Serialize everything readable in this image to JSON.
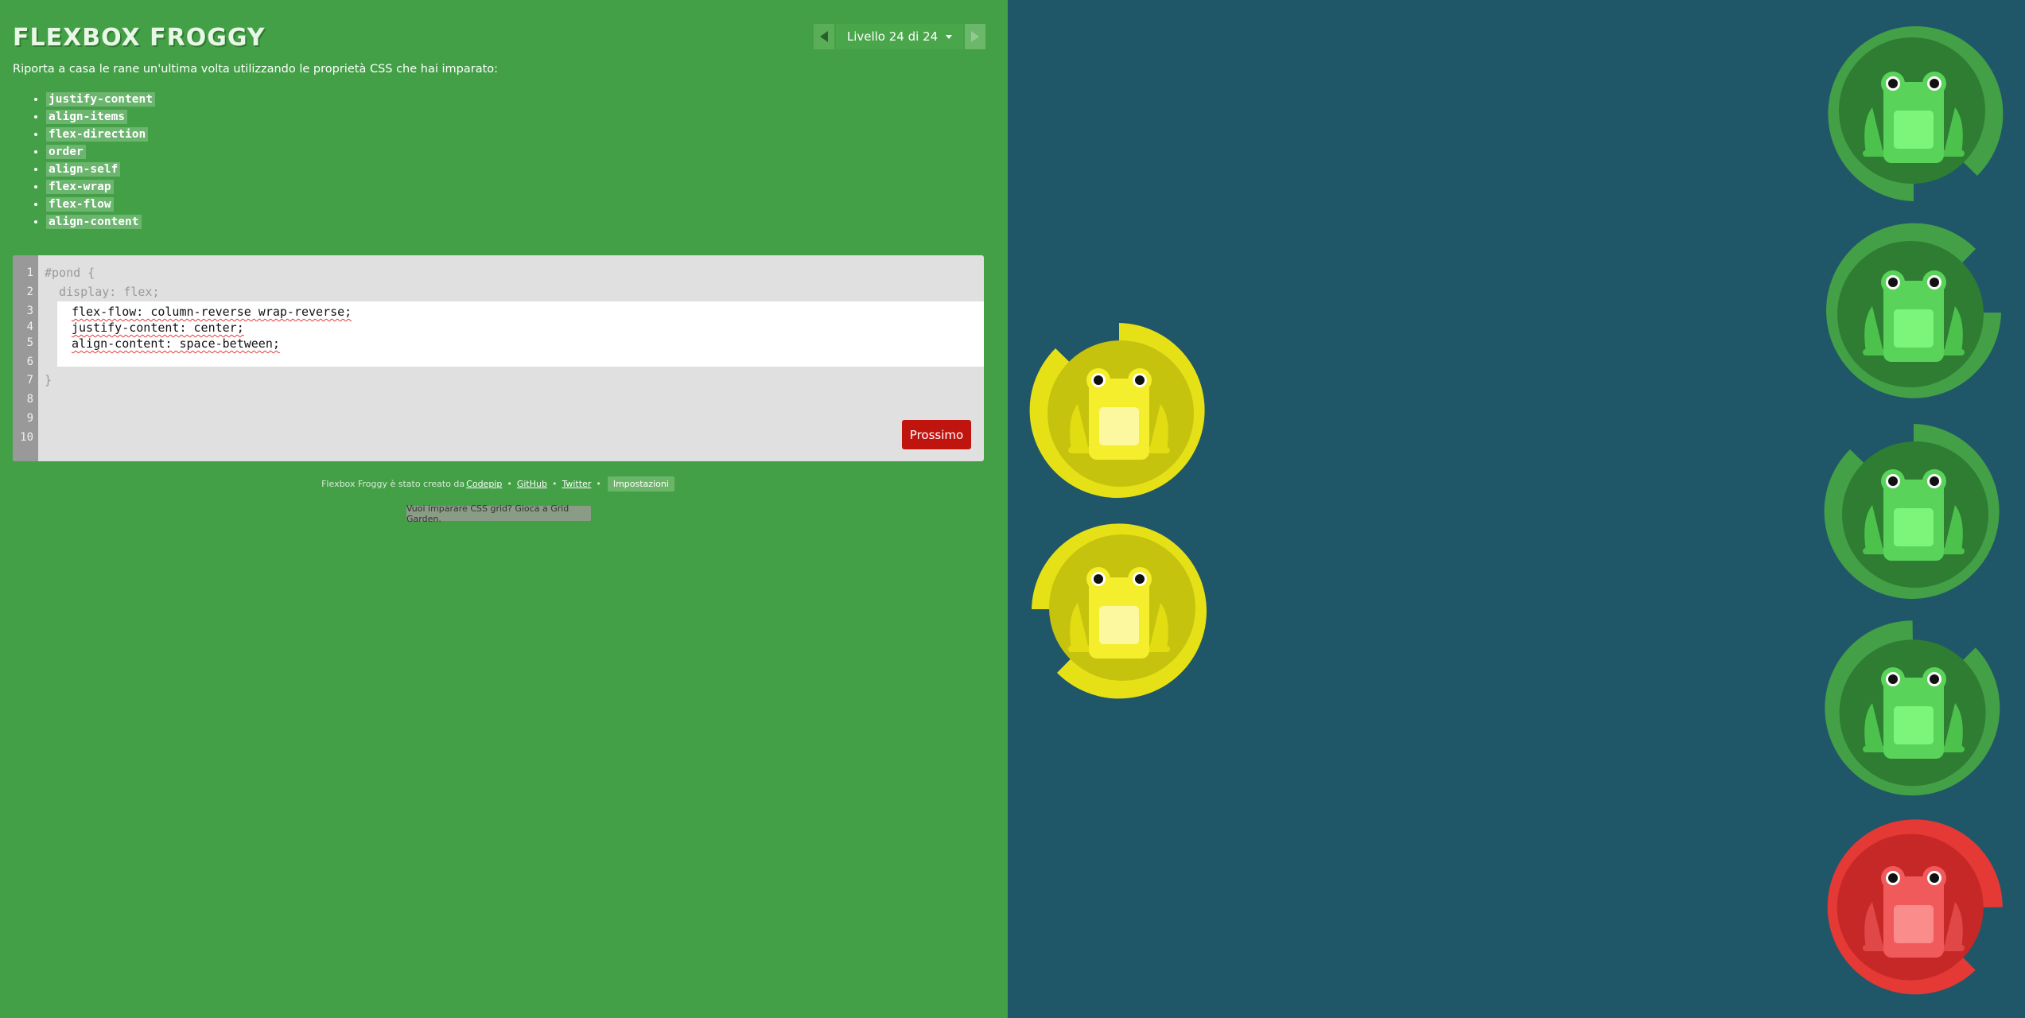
{
  "header": {
    "title": "FLEXBOX FROGGY",
    "level_label": "Livello 24 di 24"
  },
  "instructions": "Riporta a casa le rane un'ultima volta utilizzando le proprietà CSS che hai imparato:",
  "properties": [
    "justify-content",
    "align-items",
    "flex-direction",
    "order",
    "align-self",
    "flex-wrap",
    "flex-flow",
    "align-content"
  ],
  "editor": {
    "line_numbers": [
      "1",
      "2",
      "3",
      "4",
      "5",
      "6",
      "7",
      "8",
      "9",
      "10"
    ],
    "line1": "#pond {",
    "line2": "  display: flex;",
    "input_lines": [
      "flex-flow: column-reverse wrap-reverse;",
      "justify-content: center;",
      "align-content: space-between;"
    ],
    "closing": "}",
    "next_label": "Prossimo"
  },
  "footer": {
    "credit_text": "Flexbox Froggy è stato creato da",
    "codepip": "Codepip",
    "github": "GitHub",
    "twitter": "Twitter",
    "separator": "•",
    "settings_label": "Impostazioni",
    "grid_garden": "Vuoi imparare CSS grid? Gioca a Grid Garden."
  },
  "pond": {
    "lilypads": [
      {
        "color": "yellow",
        "pad_color": "#e6e117",
        "pad_dark": "#c6c30f",
        "rotation": 0
      },
      {
        "color": "yellow",
        "pad_color": "#e6e117",
        "pad_dark": "#c6c30f",
        "rotation": 270
      },
      {
        "color": "green",
        "pad_color": "#43a047",
        "pad_dark": "#2e7d32",
        "rotation": 180
      },
      {
        "color": "green",
        "pad_color": "#43a047",
        "pad_dark": "#2e7d32",
        "rotation": 90
      },
      {
        "color": "green",
        "pad_color": "#43a047",
        "pad_dark": "#2e7d32",
        "rotation": 0
      },
      {
        "color": "green",
        "pad_color": "#43a047",
        "pad_dark": "#2e7d32",
        "rotation": 45
      },
      {
        "color": "red",
        "pad_color": "#e53935",
        "pad_dark": "#c62828",
        "rotation": 135
      }
    ],
    "frogs": [
      {
        "color": "yellow",
        "body": "#f4ee2c",
        "belly": "#fcf8a0",
        "foot": "#e2dc12"
      },
      {
        "color": "yellow",
        "body": "#f4ee2c",
        "belly": "#fcf8a0",
        "foot": "#e2dc12"
      },
      {
        "color": "green",
        "body": "#5ad35a",
        "belly": "#7cf57a",
        "foot": "#4cc24c"
      },
      {
        "color": "green",
        "body": "#5ad35a",
        "belly": "#7cf57a",
        "foot": "#4cc24c"
      },
      {
        "color": "green",
        "body": "#5ad35a",
        "belly": "#7cf57a",
        "foot": "#4cc24c"
      },
      {
        "color": "green",
        "body": "#5ad35a",
        "belly": "#7cf57a",
        "foot": "#4cc24c"
      },
      {
        "color": "red",
        "body": "#f05a5a",
        "belly": "#fa8c8c",
        "foot": "#e04848"
      }
    ]
  }
}
